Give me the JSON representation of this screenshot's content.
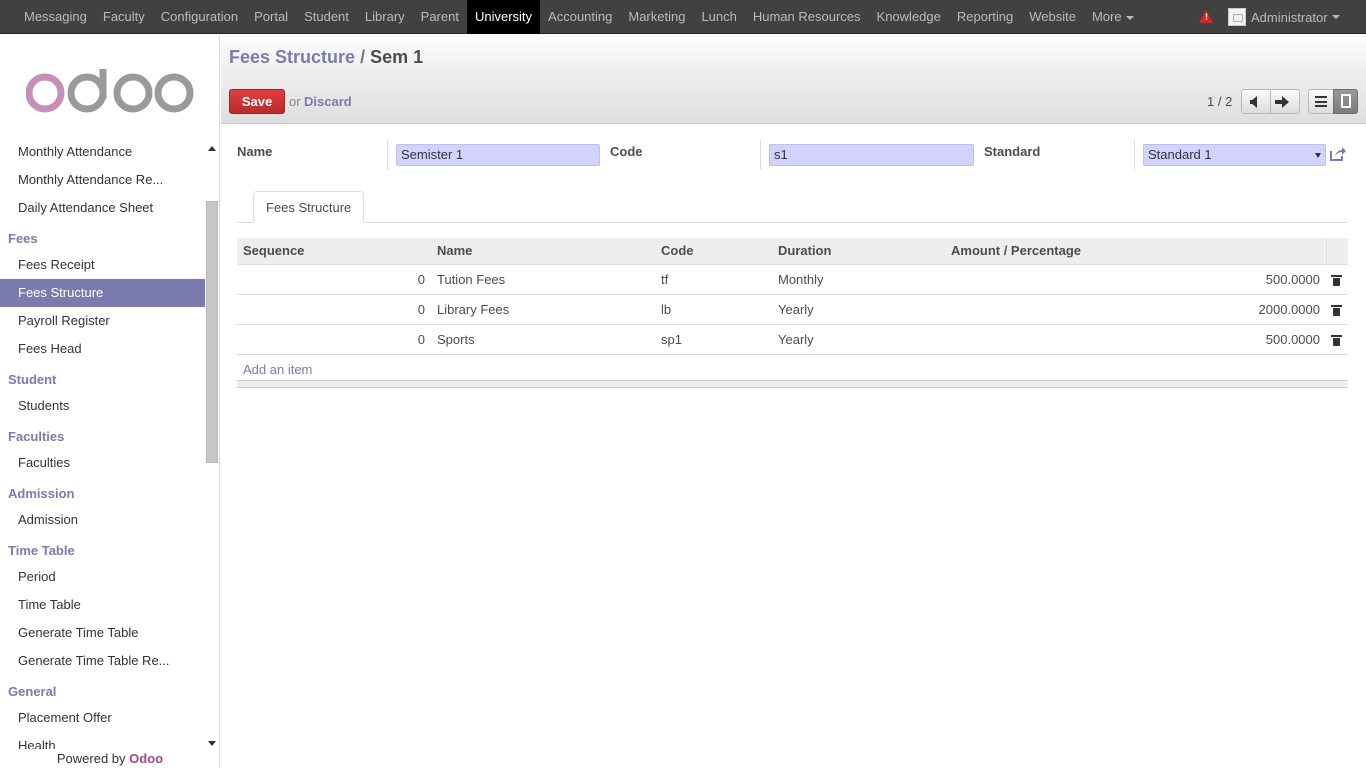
{
  "topnav": {
    "items": [
      "Messaging",
      "Faculty",
      "Configuration",
      "Portal",
      "Student",
      "Library",
      "Parent",
      "University",
      "Accounting",
      "Marketing",
      "Lunch",
      "Human Resources",
      "Knowledge",
      "Reporting",
      "Website",
      "More"
    ],
    "active": "University",
    "user": "Administrator"
  },
  "sidebar": {
    "top_items": [
      "Monthly Attendance",
      "Monthly Attendance Re...",
      "Daily Attendance Sheet"
    ],
    "sections": [
      {
        "title": "Fees",
        "items": [
          "Fees Receipt",
          "Fees Structure",
          "Payroll Register",
          "Fees Head"
        ]
      },
      {
        "title": "Student",
        "items": [
          "Students"
        ]
      },
      {
        "title": "Faculties",
        "items": [
          "Faculties"
        ]
      },
      {
        "title": "Admission",
        "items": [
          "Admission"
        ]
      },
      {
        "title": "Time Table",
        "items": [
          "Period",
          "Time Table",
          "Generate Time Table",
          "Generate Time Table Re..."
        ]
      },
      {
        "title": "General",
        "items": [
          "Placement Offer",
          "Health"
        ]
      }
    ],
    "active_item": "Fees Structure",
    "powered_prefix": "Powered by",
    "powered_brand": "Odoo"
  },
  "control_panel": {
    "breadcrumb_parent": "Fees Structure",
    "breadcrumb_sep": "/",
    "breadcrumb_current": "Sem 1",
    "save_label": "Save",
    "or_text": "or",
    "discard_label": "Discard",
    "pager": "1 / 2"
  },
  "form": {
    "name_label": "Name",
    "name_value": "Semister 1",
    "code_label": "Code",
    "code_value": "s1",
    "standard_label": "Standard",
    "standard_value": "Standard 1",
    "tab_label": "Fees Structure",
    "columns": [
      "Sequence",
      "Name",
      "Code",
      "Duration",
      "Amount / Percentage"
    ],
    "lines": [
      {
        "sequence": "0",
        "name": "Tution Fees",
        "code": "tf",
        "duration": "Monthly",
        "amount": "500.0000"
      },
      {
        "sequence": "0",
        "name": "Library Fees",
        "code": "lb",
        "duration": "Yearly",
        "amount": "2000.0000"
      },
      {
        "sequence": "0",
        "name": "Sports",
        "code": "sp1",
        "duration": "Yearly",
        "amount": "500.0000"
      }
    ],
    "add_item_label": "Add an item"
  },
  "colors": {
    "brand": "#7c7bad",
    "save": "#d9534f",
    "topbar": "#414141",
    "input_bg": "#d2d2ff"
  }
}
